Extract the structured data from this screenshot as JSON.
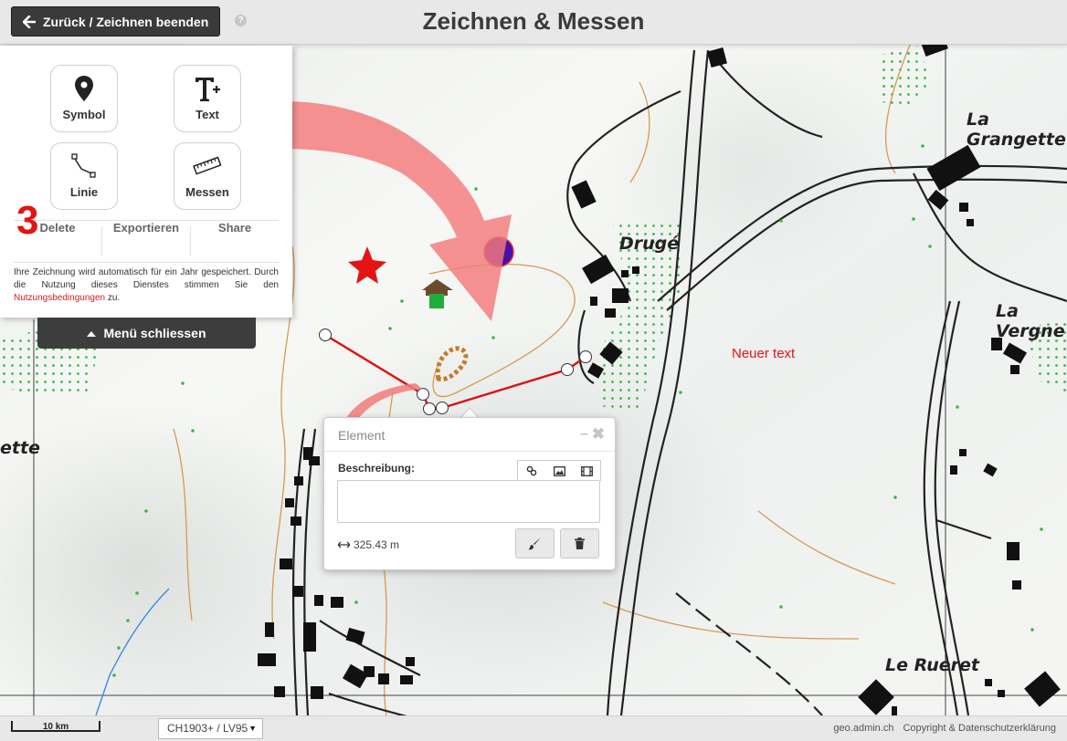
{
  "header": {
    "back_label": "Zurück / Zeichnen beenden",
    "help_label": "?",
    "title": "Zeichnen & Messen"
  },
  "tools": {
    "symbol": "Symbol",
    "text": "Text",
    "line": "Linie",
    "measure": "Messen"
  },
  "actions": {
    "delete": "Delete",
    "export": "Exportieren",
    "share": "Share"
  },
  "notice": {
    "text": "Ihre Zeichnung wird automatisch für ein Jahr gespeichert. Durch die Nutzung dieses Dienstes stimmen Sie den",
    "link": "Nutzungsbedingungen",
    "suffix": "zu."
  },
  "step_number": "3",
  "menu_close_label": "Menü schliessen",
  "popup": {
    "title": "Element",
    "description_label": "Beschreibung:",
    "description_value": "",
    "measure_value": "325.43 m"
  },
  "map": {
    "drawn_text": "Neuer text",
    "places": {
      "druge": "Drugé",
      "la_grangette": "La Grangette",
      "la_vergne": "La Vergne",
      "le_rueret": "Le Rueret",
      "ette": "ette"
    }
  },
  "footer": {
    "scale_label": "10 km",
    "projection": "CH1903+ / LV95",
    "site": "geo.admin.ch",
    "copyright": "Copyright & Datenschutzerklärung"
  },
  "colors": {
    "topbar_bg": "#e8e8e8",
    "button_dark": "#3a3a3a",
    "accent_red": "#e31414",
    "arrow_pink": "#f47a7a",
    "contour": "#d49a55",
    "forest_dot": "#3bb54a"
  }
}
